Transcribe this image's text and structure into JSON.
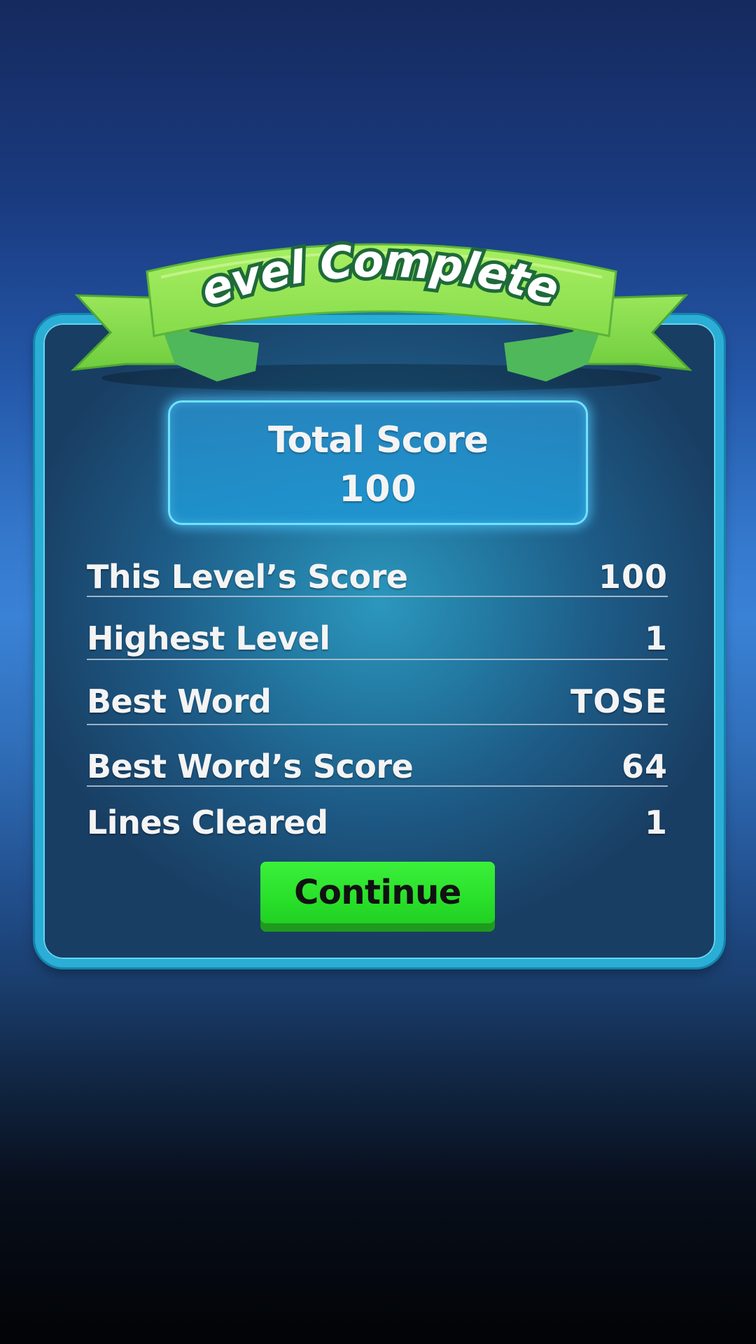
{
  "banner": {
    "title": "Level Completed"
  },
  "total_score": {
    "label": "Total Score",
    "value": "100"
  },
  "stats": [
    {
      "label": "This Level’s Score",
      "value": "100"
    },
    {
      "label": "Highest Level",
      "value": "1"
    },
    {
      "label": "Best Word",
      "value": "TOSE"
    },
    {
      "label": "Best Word’s Score",
      "value": "64"
    },
    {
      "label": "Lines Cleared",
      "value": "1"
    }
  ],
  "continue_button": {
    "label": "Continue"
  },
  "colors": {
    "banner_green": "#9be85a",
    "panel_border": "#2aaed6",
    "button_green": "#2fe22e",
    "text": "#f4f4f4"
  }
}
